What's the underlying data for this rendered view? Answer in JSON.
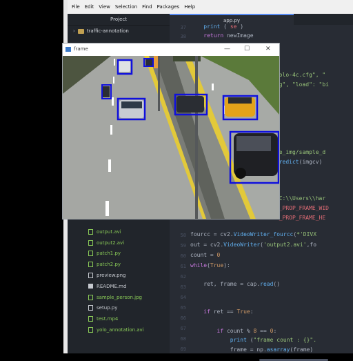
{
  "menu": [
    "File",
    "Edit",
    "View",
    "Selection",
    "Find",
    "Packages",
    "Help"
  ],
  "tree": {
    "header": "Project",
    "root": "traffic-annotation",
    "files": [
      {
        "name": "output.avi",
        "kind": "media"
      },
      {
        "name": "output2.avi",
        "kind": "media"
      },
      {
        "name": "patch1.py",
        "kind": "py"
      },
      {
        "name": "patch2.py",
        "kind": "py"
      },
      {
        "name": "preview.png",
        "kind": "plain"
      },
      {
        "name": "README.md",
        "kind": "md"
      },
      {
        "name": "sample_person.jpg",
        "kind": "media"
      },
      {
        "name": "setup.py",
        "kind": "plain"
      },
      {
        "name": "test.mp4",
        "kind": "media"
      },
      {
        "name": "yolo_annotation.avi",
        "kind": "media"
      }
    ]
  },
  "editor": {
    "tab": "app.py"
  },
  "frame_window": {
    "title": "frame",
    "minimize": "—",
    "maximize": "☐",
    "close": "✕"
  },
  "icons": {
    "folder": "folder-icon",
    "file": "file-icon",
    "window": "window-icon"
  },
  "colors": {
    "box": "#1010dd",
    "accent": "#568af2",
    "file_green": "#89c957"
  }
}
